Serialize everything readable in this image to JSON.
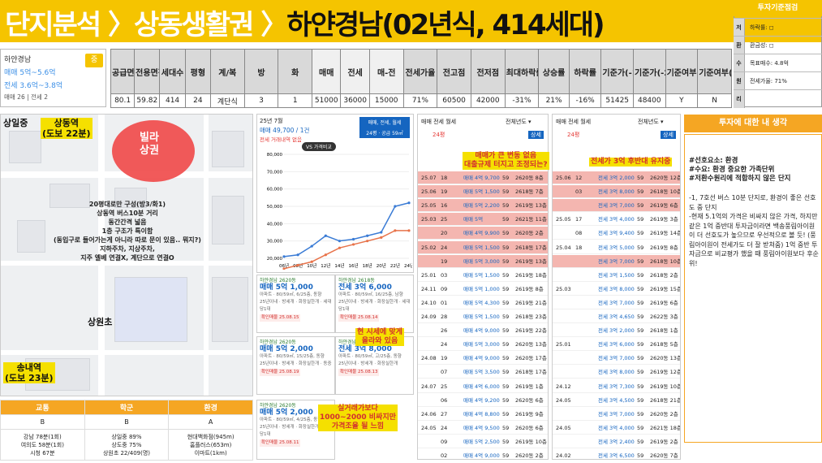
{
  "banner": {
    "title_part1": "단지분석 ",
    "title_part2": "상동생활권 ",
    "title_part3": "하얀경남(02년식, 414세대)"
  },
  "complex": {
    "name": "하얀경남",
    "badge": "중",
    "sale": "매매 5억~5.6억",
    "jeonse": "전세 3.6억~3.8억",
    "counts": "매매 26 | 전세 2"
  },
  "criteria": {
    "title": "투자기준점검",
    "rows": [
      {
        "k": "저",
        "v": "하락률: ◻"
      },
      {
        "k": "환",
        "v": "환금성: ◻"
      },
      {
        "k": "수",
        "v": "목표매수: 4.8억"
      },
      {
        "k": "원",
        "v": "전세가율: 71%"
      },
      {
        "k": "리",
        "v": ""
      }
    ]
  },
  "top_table": {
    "headers": [
      "공급면적",
      "전용면적",
      "세대수",
      "평형",
      "계/복",
      "방",
      "화",
      "매매",
      "전세",
      "매-전",
      "전세가율",
      "전고점",
      "전저점",
      "최대하락률",
      "상승률",
      "하락률",
      "기준가(-15%)",
      "기준가(-20%)",
      "기준여부(-15%)",
      "기준여부(-20%)"
    ],
    "row": [
      "80.1",
      "59.82",
      "414",
      "24",
      "계단식",
      "3",
      "1",
      "51000",
      "36000",
      "15000",
      "71%",
      "60500",
      "42000",
      "-31%",
      "21%",
      "-16%",
      "51425",
      "48400",
      "Y",
      "N"
    ]
  },
  "map": {
    "labels": [
      "상일중",
      "상동역\n(도보 22분)",
      "빌라\n상권",
      "상원초",
      "송내역\n(도보 23분)"
    ],
    "note": "20평대로만 구성(방3/화1)\n상동역 버스10분 거리\n동간간격 넓음\n1층 구조가 특이함\n(동입구로 들어가는게 아니라 따로 문이 있음.. 뭐지?)\n지하주차, 지상주차,\n지주 엘베 연결X, 계단으로 연결O"
  },
  "ratings": {
    "headers": [
      "교통",
      "학군",
      "환경"
    ],
    "grades": [
      "B",
      "B",
      "A"
    ],
    "details": [
      "강남 78분(1회)\n여의도 58분(1회)\n시청 67분",
      "상일중 89%\n상도중 75%\n상원초 22/409(명)",
      "현대백화점(945m)\n홈플러스(653m)\n이마트(1km)"
    ]
  },
  "chart": {
    "period": "25년 7월",
    "sale": "매매 49,700 / 1건",
    "jeonse": "전세 거래내역 없음",
    "filter": "매매, 전세, 월세",
    "size": "24평 · 공급 59㎡",
    "compare": "VS 가격비교",
    "y_ticks": [
      "80,000",
      "70,000",
      "60,000",
      "50,000",
      "40,000",
      "30,000",
      "20,000"
    ],
    "x_ticks": [
      "06년",
      "08년",
      "10년",
      "12년",
      "14년",
      "16년",
      "18년",
      "20년",
      "22년",
      "24년"
    ]
  },
  "chart_data": {
    "type": "line",
    "series": [
      {
        "name": "매매",
        "values": [
          21000,
          22000,
          27000,
          33000,
          30000,
          31000,
          33000,
          35000,
          50000,
          52000
        ]
      },
      {
        "name": "전세",
        "values": [
          14000,
          16000,
          18000,
          22000,
          26000,
          28000,
          30000,
          32000,
          36000,
          36000
        ]
      }
    ],
    "x": [
      "06년",
      "08년",
      "10년",
      "12년",
      "14년",
      "16년",
      "18년",
      "20년",
      "22년",
      "24년"
    ],
    "ylim": [
      20000,
      80000
    ]
  },
  "listings": [
    {
      "tag": "하얀경남 2620동",
      "price": "매매 5억 1,000",
      "line1": "아파트 · 80/59㎡, 6/25층, 동향",
      "line2": "25년이내 · 방세개 · 화장실한개 · 세대당1대",
      "conf": "확인매물 25.08.15"
    },
    {
      "tag": "하얀경남 2618동",
      "price": "전세 3억 6,000",
      "line1": "아파트 · 80/59㎡, 16/25층, 남향",
      "line2": "25년이내 · 방세개 · 화장실한개 · 세대당1대",
      "conf": "확인매물 25.08.14"
    },
    {
      "tag": "하얀경남 2620동",
      "price": "매매 5억 2,000",
      "line1": "아파트 · 80/59㎡, 15/25층, 동향",
      "line2": "25년이내 · 방세개 · 화장실한개 · 동중",
      "conf": "확인매물 25.08.19"
    },
    {
      "tag": "하얀경남 2618동",
      "price": "전세 3억 8,000",
      "line1": "아파트 · 80/59㎡, 고/25층, 동향",
      "line2": "25년이내 · 방세개 · 화장실한개",
      "conf": "확인매물 25.08.13"
    },
    {
      "tag": "하얀경남 2620동",
      "price": "매매 5억 2,000",
      "line1": "아파트 · 80/59㎡, 4/25층, 동향",
      "line2": "25년이내 · 방세개 · 화장실한개 · 세대당1대",
      "conf": "확인매물 25.08.11"
    }
  ],
  "notes": {
    "sale_change": "매매가 큰 변동 없음\n대출규제 터지고 조정되는?",
    "jeonse_hold": "전세가 3억 후반대 유지중",
    "jeonse_current": "현 시세에 맞게\n올라와 있음",
    "sale_current": "실거래가보다\n1000~2000 비싸지만\n가격조율 될 느낌"
  },
  "tx_sale": {
    "tabs": "매매  전세  월세",
    "sort": "전체년도 ▾",
    "size": "24평",
    "detail": "상세",
    "rows": [
      [
        "25.07",
        "18",
        "매매 4억 9,700",
        "59",
        "2620동 8층",
        1
      ],
      [
        "25.06",
        "19",
        "매매 5억 1,500",
        "59",
        "2618동 7층",
        1
      ],
      [
        "25.05",
        "16",
        "매매 5억 2,200",
        "59",
        "2619동 13층",
        1
      ],
      [
        "25.03",
        "25",
        "매매 5억",
        "59",
        "2621동 11층",
        1
      ],
      [
        "",
        "20",
        "매매 4억 9,900",
        "59",
        "2620동 2층",
        1
      ],
      [
        "25.02",
        "24",
        "매매 5억 1,500",
        "59",
        "2618동 17층",
        1
      ],
      [
        "",
        "19",
        "매매 5억 3,000",
        "59",
        "2619동 13층",
        1
      ],
      [
        "25.01",
        "03",
        "매매 5억 1,500",
        "59",
        "2619동 18층",
        0
      ],
      [
        "24.11",
        "09",
        "매매 5억 1,000",
        "59",
        "2619동 8층",
        0
      ],
      [
        "24.10",
        "01",
        "매매 5억 4,300",
        "59",
        "2619동 21층",
        0
      ],
      [
        "24.09",
        "28",
        "매매 5억 1,500",
        "59",
        "2618동 23층",
        0
      ],
      [
        "",
        "26",
        "매매 4억 9,000",
        "59",
        "2619동 22층",
        0
      ],
      [
        "",
        "24",
        "매매 5억 3,000",
        "59",
        "2620동 13층",
        0
      ],
      [
        "24.08",
        "19",
        "매매 4억 9,000",
        "59",
        "2620동 17층",
        0
      ],
      [
        "",
        "07",
        "매매 5억 3,500",
        "59",
        "2618동 17층",
        0
      ],
      [
        "24.07",
        "25",
        "매매 4억 6,000",
        "59",
        "2619동 1층",
        0
      ],
      [
        "",
        "06",
        "매매 4억 9,200",
        "59",
        "2620동 6층",
        0
      ],
      [
        "24.06",
        "27",
        "매매 4억 8,800",
        "59",
        "2619동 9층",
        0
      ],
      [
        "24.05",
        "24",
        "매매 4억 9,500",
        "59",
        "2620동 6층",
        0
      ],
      [
        "",
        "09",
        "매매 5억 2,500",
        "59",
        "2619동 10층",
        0
      ],
      [
        "",
        "02",
        "매매 4억 9,000",
        "59",
        "2620동 2층",
        0
      ],
      [
        "24.04",
        "27",
        "매매 5억",
        "59",
        "2619동 20층",
        0
      ]
    ]
  },
  "tx_jeonse": {
    "tabs": "매매  전세  월세",
    "sort": "전체년도 ▾",
    "size": "24평",
    "detail": "상세",
    "rows": [
      [
        "25.06",
        "12",
        "전세 3억 2,000",
        "59",
        "2620동 12층",
        1
      ],
      [
        "",
        "03",
        "전세 3억 8,000",
        "59",
        "2618동 10층",
        1
      ],
      [
        "",
        "",
        "전세 3억 7,000",
        "59",
        "2619동 6층",
        1
      ],
      [
        "25.05",
        "17",
        "전세 3억 4,000",
        "59",
        "2619동 3층",
        0
      ],
      [
        "",
        "08",
        "전세 3억 9,400",
        "59",
        "2619동 14층",
        0
      ],
      [
        "25.04",
        "18",
        "전세 3억 5,000",
        "59",
        "2619동 8층",
        0
      ],
      [
        "",
        "",
        "전세 3억 7,000",
        "59",
        "2618동 10층",
        1
      ],
      [
        "",
        "",
        "전세 3억 1,500",
        "59",
        "2618동 2층",
        0
      ],
      [
        "25.03",
        "",
        "전세 3억 8,000",
        "59",
        "2619동 15층",
        0
      ],
      [
        "",
        "",
        "전세 3억 7,000",
        "59",
        "2619동 6층",
        0
      ],
      [
        "",
        "",
        "전세 3억 4,650",
        "59",
        "2622동 3층",
        0
      ],
      [
        "",
        "",
        "전세 3억 2,000",
        "59",
        "2618동 1층",
        0
      ],
      [
        "25.01",
        "",
        "전세 3억 6,000",
        "59",
        "2618동 5층",
        0
      ],
      [
        "",
        "",
        "전세 3억 7,000",
        "59",
        "2620동 13층",
        0
      ],
      [
        "",
        "",
        "전세 3억 8,000",
        "59",
        "2619동 12층",
        0
      ],
      [
        "24.12",
        "",
        "전세 3억 7,300",
        "59",
        "2619동 10층",
        0
      ],
      [
        "24.05",
        "",
        "전세 3억 4,500",
        "59",
        "2618동 21층",
        0
      ],
      [
        "",
        "",
        "전세 3억 7,000",
        "59",
        "2620동 2층",
        0
      ],
      [
        "24.05",
        "",
        "전세 3억 4,000",
        "59",
        "2621동 18층",
        0
      ],
      [
        "",
        "",
        "전세 3억 2,400",
        "59",
        "2619동 2층",
        0
      ],
      [
        "24.02",
        "",
        "전세 3억 6,500",
        "59",
        "2620동 7층",
        0
      ],
      [
        "23.11",
        "",
        "전세 3억 5,000",
        "59",
        "2619동 6층",
        0
      ]
    ]
  },
  "thoughts": {
    "title": "투자에 대한 내 생각",
    "tags": "#선호요소: 환경\n#수요: 환경 중요한 가족단위\n#저환수원리에 적합하지 않은 단지",
    "body": "-1, 7호선 버스 10분 단지로, 환경이 좋은 선호도 중 단지\n-현재 5.1억의 가격은 비싸지 않은 가격, 하지만 같은 1억 중반대 투자금이라면 백송풍림아이원이 더 선호도가 높으므로 우선적으로 볼 듯! (풍림아이원이 전세가도 더 잘 받쳐줌) 1억 중반 투자금으로 비교평가 했을 때 풍림아이원보다 후순위!"
  }
}
